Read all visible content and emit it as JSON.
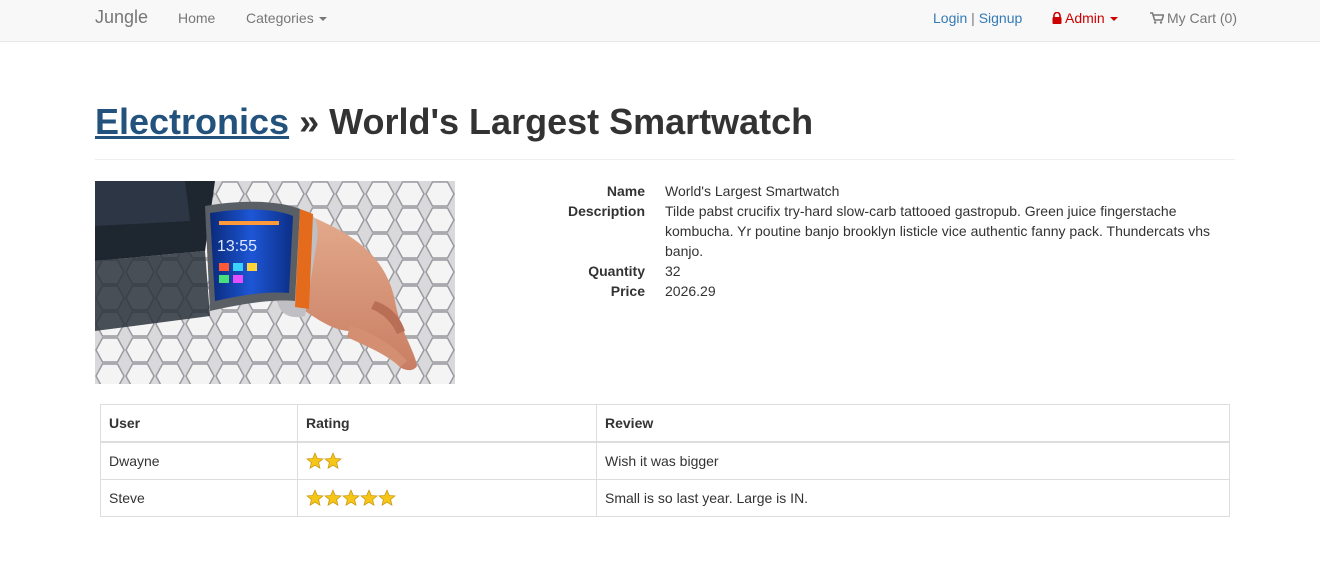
{
  "navbar": {
    "brand": "Jungle",
    "home": "Home",
    "categories": "Categories",
    "login": "Login",
    "separator": "|",
    "signup": "Signup",
    "admin": "Admin",
    "cart": "My Cart (0)"
  },
  "header": {
    "category": "Electronics",
    "separator": "»",
    "title": "World's Largest Smartwatch"
  },
  "product": {
    "name_label": "Name",
    "name": "World's Largest Smartwatch",
    "description_label": "Description",
    "description": "Tilde pabst crucifix try-hard slow-carb tattooed gastropub. Green juice fingerstache kombucha. Yr poutine banjo brooklyn listicle vice authentic fanny pack. Thundercats vhs banjo.",
    "quantity_label": "Quantity",
    "quantity": "32",
    "price_label": "Price",
    "price": "2026.29"
  },
  "reviews": {
    "headers": [
      "User",
      "Rating",
      "Review"
    ],
    "rows": [
      {
        "user": "Dwayne",
        "rating": 2,
        "review": "Wish it was bigger"
      },
      {
        "user": "Steve",
        "rating": 5,
        "review": "Small is so last year. Large is IN."
      }
    ]
  },
  "colors": {
    "link": "#337ab7",
    "admin": "#cc0000",
    "star": "#f5c518"
  }
}
